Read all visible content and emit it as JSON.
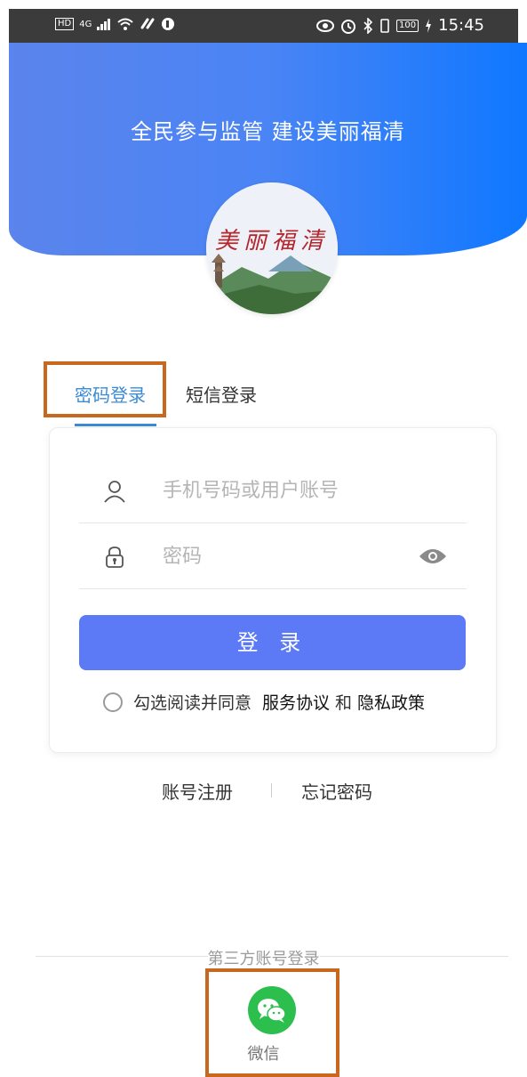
{
  "status_bar": {
    "left_badge": "HD",
    "signal_label": "4G",
    "battery": "100",
    "time": "15:45"
  },
  "header": {
    "slogan": "全民参与监管 建设美丽福清",
    "logo_text": "美丽福清"
  },
  "tabs": [
    {
      "label": "密码登录",
      "active": true
    },
    {
      "label": "短信登录",
      "active": false
    }
  ],
  "form": {
    "account_placeholder": "手机号码或用户账号",
    "password_placeholder": "密码",
    "login_label": "登 录",
    "agree_prefix": "勾选阅读并同意",
    "service_link": "服务协议",
    "and": "和",
    "privacy_link": "隐私政策"
  },
  "aux_links": {
    "register": "账号注册",
    "forgot": "忘记密码"
  },
  "third_party": {
    "title": "第三方账号登录",
    "wechat_label": "微信"
  },
  "colors": {
    "accent": "#3c8bd6",
    "button": "#5c7af6",
    "wechat": "#2dbf4e",
    "highlight": "#c8681e"
  }
}
